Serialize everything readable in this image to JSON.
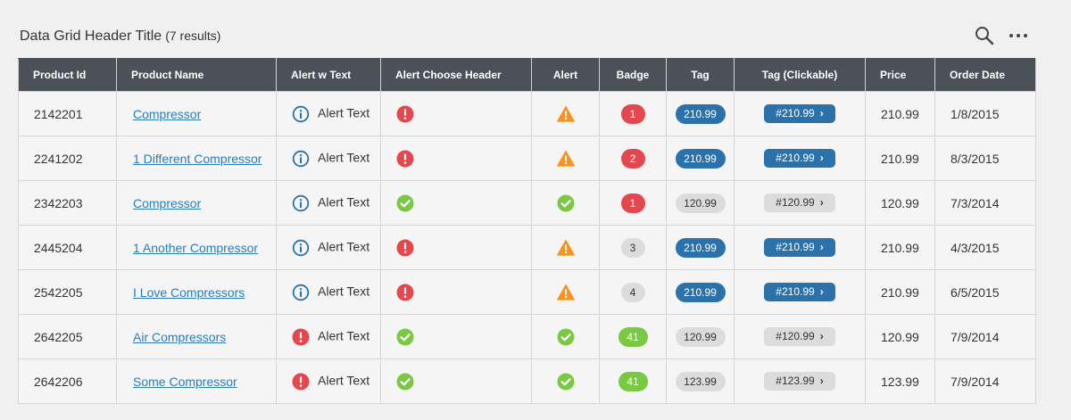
{
  "header": {
    "title": "Data Grid Header Title",
    "count": "(7 results)"
  },
  "columns": [
    "Product Id",
    "Product Name",
    "Alert w Text",
    "Alert Choose Header",
    "Alert",
    "Badge",
    "Tag",
    "Tag (Clickable)",
    "Price",
    "Order Date"
  ],
  "rows": [
    {
      "id": "2142201",
      "name": "Compressor",
      "alert_text": "Alert Text",
      "alert_text_icon": "info-icon",
      "choose_icon": "error-icon",
      "alert_icon": "warning-icon",
      "badge": "1",
      "badge_color": "red",
      "tag": "210.99",
      "tag_color": "blue",
      "ctag": "#210.99",
      "ctag_color": "blue",
      "price": "210.99",
      "date": "1/8/2015"
    },
    {
      "id": "2241202",
      "name": "1 Different Compressor",
      "alert_text": "Alert Text",
      "alert_text_icon": "info-icon",
      "choose_icon": "error-icon",
      "alert_icon": "warning-icon",
      "badge": "2",
      "badge_color": "red",
      "tag": "210.99",
      "tag_color": "blue",
      "ctag": "#210.99",
      "ctag_color": "blue",
      "price": "210.99",
      "date": "8/3/2015"
    },
    {
      "id": "2342203",
      "name": "Compressor",
      "alert_text": "Alert Text",
      "alert_text_icon": "info-icon",
      "choose_icon": "success-icon",
      "alert_icon": "success-icon",
      "badge": "1",
      "badge_color": "red",
      "tag": "120.99",
      "tag_color": "grey",
      "ctag": "#120.99",
      "ctag_color": "grey",
      "price": "120.99",
      "date": "7/3/2014"
    },
    {
      "id": "2445204",
      "name": "1 Another Compressor",
      "alert_text": "Alert Text",
      "alert_text_icon": "info-icon",
      "choose_icon": "error-icon",
      "alert_icon": "warning-icon",
      "badge": "3",
      "badge_color": "grey",
      "tag": "210.99",
      "tag_color": "blue",
      "ctag": "#210.99",
      "ctag_color": "blue",
      "price": "210.99",
      "date": "4/3/2015"
    },
    {
      "id": "2542205",
      "name": "I Love Compressors",
      "alert_text": "Alert Text",
      "alert_text_icon": "info-icon",
      "choose_icon": "error-icon",
      "alert_icon": "warning-icon",
      "badge": "4",
      "badge_color": "grey",
      "tag": "210.99",
      "tag_color": "blue",
      "ctag": "#210.99",
      "ctag_color": "blue",
      "price": "210.99",
      "date": "6/5/2015"
    },
    {
      "id": "2642205",
      "name": "Air Compressors",
      "alert_text": "Alert Text",
      "alert_text_icon": "error-icon",
      "choose_icon": "success-icon",
      "alert_icon": "success-icon",
      "badge": "41",
      "badge_color": "green",
      "tag": "120.99",
      "tag_color": "grey",
      "ctag": "#120.99",
      "ctag_color": "grey",
      "price": "120.99",
      "date": "7/9/2014"
    },
    {
      "id": "2642206",
      "name": "Some Compressor",
      "alert_text": "Alert Text",
      "alert_text_icon": "error-icon",
      "choose_icon": "success-icon",
      "alert_icon": "success-icon",
      "badge": "41",
      "badge_color": "green",
      "tag": "123.99",
      "tag_color": "grey",
      "ctag": "#123.99",
      "ctag_color": "grey",
      "price": "123.99",
      "date": "7/9/2014"
    }
  ],
  "colors": {
    "header_bg": "#4c5059",
    "link": "#2b7cb6",
    "info": "#2b72aa",
    "error": "#e4474d",
    "warning": "#f7931e",
    "success": "#7ac943",
    "tag_blue": "#2b72aa",
    "tag_grey": "#dcdcdc"
  }
}
